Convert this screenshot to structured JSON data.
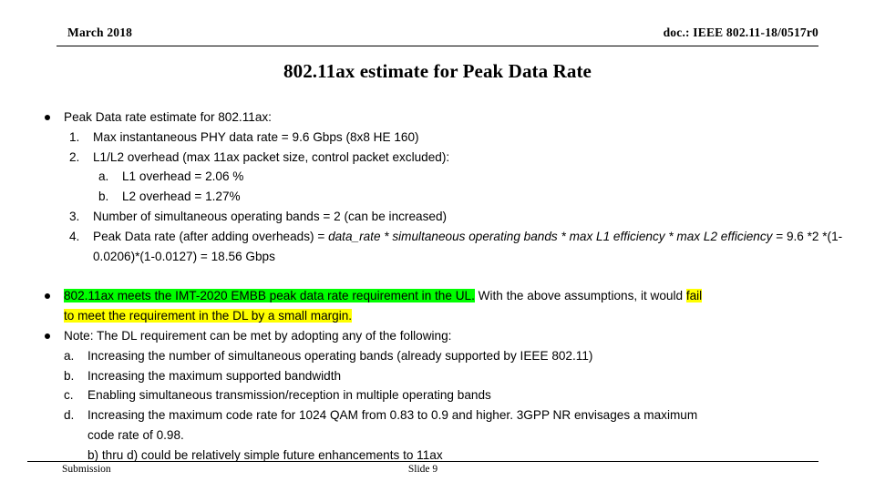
{
  "header": {
    "left": "March  2018",
    "right": "doc.: IEEE 802.11-18/0517r0"
  },
  "title": "802.11ax estimate for Peak Data Rate",
  "body": {
    "bullet1": "Peak Data rate estimate for 802.11ax:",
    "item1_mark": "1.",
    "item1": "Max instantaneous PHY data rate = 9.6 Gbps (8x8 HE 160)",
    "item2_mark": "2.",
    "item2": "L1/L2 overhead (max 11ax  packet size, control packet excluded):",
    "item2a_mark": "a.",
    "item2a": "L1 overhead =  2.06 %",
    "item2b_mark": "b.",
    "item2b": "L2 overhead = 1.27%",
    "item3_mark": "3.",
    "item3": "Number of simultaneous operating bands = 2 (can be increased)",
    "item4_mark": "4.",
    "item4_part1": "Peak Data rate (after adding overheads) = ",
    "item4_italic1": "data_rate * simultaneous operating bands * max L1 efficiency * max L2 efficiency",
    "item4_part2": " = 9.6 *2 *(1-0.0206)*(1-0.0127) = 18.56 Gbps",
    "bullet2_green": "802.11ax meets the IMT-2020 EMBB peak data rate  requirement in the UL.",
    "bullet2_plain": " With the above assumptions, it would ",
    "bullet2_yellow1": "fail",
    "bullet2_yellow2": "to meet the requirement in the DL by a small margin.",
    "bullet3": "Note: The DL requirement can be met by adopting any of the following:",
    "item_a_mark": "a.",
    "item_a": "Increasing the number of simultaneous operating bands (already supported by IEEE 802.11)",
    "item_b_mark": "b.",
    "item_b": "Increasing the maximum supported bandwidth",
    "item_c_mark": "c.",
    "item_c": "Enabling simultaneous transmission/reception in multiple operating bands",
    "item_d_mark": "d.",
    "item_d_line1": "Increasing the maximum code rate for 1024 QAM from 0.83 to 0.9 and higher. 3GPP NR envisages a maximum",
    "item_d_line2": "code rate of 0.98.",
    "item_e": "b) thru d) could be relatively simple future enhancements to 11ax"
  },
  "footer": {
    "left": "Submission",
    "center": "Slide 9"
  },
  "colors": {
    "highlight_green": "#00ff00",
    "highlight_yellow": "#ffff00",
    "text": "#000000",
    "background": "#ffffff"
  }
}
